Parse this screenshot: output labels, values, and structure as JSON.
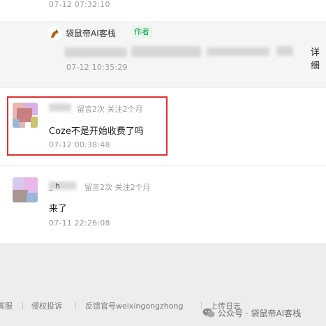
{
  "top_comment": {
    "time": "07-12 07:32:10"
  },
  "reply": {
    "author": "袋鼠帝AI客栈",
    "badge": "作者",
    "text_visible": "详细",
    "time": "07-12 10:35:29"
  },
  "comments": [
    {
      "name": "Ds",
      "meta": "留言2次 关注2个月",
      "text": "Coze不是开始收费了吗",
      "time": "07-12 00:38:48",
      "highlighted": true
    },
    {
      "name": "_ h",
      "meta": "留言2次 关注2个月",
      "text": "来了",
      "time": "07-11 22:26:08",
      "highlighted": false
    }
  ],
  "footer": {
    "links": [
      "客服",
      "侵权投诉",
      "反馈官号weixingongzhong",
      "上传日志"
    ],
    "watermark": "公众号 · 袋鼠帝AI客栈"
  },
  "colors": {
    "highlight_border": "#e03030",
    "author_badge": "#0f9f4e"
  }
}
